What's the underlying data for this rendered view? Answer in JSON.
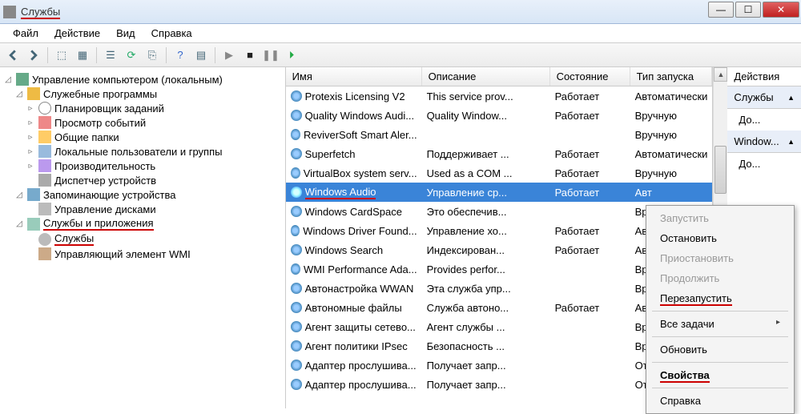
{
  "window": {
    "title": "Службы",
    "menu": [
      "Файл",
      "Действие",
      "Вид",
      "Справка"
    ]
  },
  "tree": {
    "root": "Управление компьютером (локальным)",
    "groups": [
      {
        "label": "Служебные программы",
        "items": [
          "Планировщик заданий",
          "Просмотр событий",
          "Общие папки",
          "Локальные пользователи и группы",
          "Производительность",
          "Диспетчер устройств"
        ]
      },
      {
        "label": "Запоминающие устройства",
        "items": [
          "Управление дисками"
        ]
      },
      {
        "label": "Службы и приложения",
        "items": [
          "Службы",
          "Управляющий элемент WMI"
        ]
      }
    ]
  },
  "columns": {
    "name": "Имя",
    "desc": "Описание",
    "state": "Состояние",
    "start": "Тип запуска"
  },
  "services": [
    {
      "name": "Protexis Licensing V2",
      "desc": "This service prov...",
      "state": "Работает",
      "start": "Автоматически"
    },
    {
      "name": "Quality Windows Audi...",
      "desc": "Quality Window...",
      "state": "Работает",
      "start": "Вручную"
    },
    {
      "name": "ReviverSoft Smart Aler...",
      "desc": "",
      "state": "",
      "start": "Вручную"
    },
    {
      "name": "Superfetch",
      "desc": "Поддерживает ...",
      "state": "Работает",
      "start": "Автоматически"
    },
    {
      "name": "VirtualBox system serv...",
      "desc": "Used as a COM ...",
      "state": "Работает",
      "start": "Вручную"
    },
    {
      "name": "Windows Audio",
      "desc": "Управление ср...",
      "state": "Работает",
      "start": "Авт"
    },
    {
      "name": "Windows CardSpace",
      "desc": "Это обеспечив...",
      "state": "",
      "start": "Вру"
    },
    {
      "name": "Windows Driver Found...",
      "desc": "Управление хо...",
      "state": "Работает",
      "start": "Авт"
    },
    {
      "name": "Windows Search",
      "desc": "Индексирован...",
      "state": "Работает",
      "start": "Авт"
    },
    {
      "name": "WMI Performance Ada...",
      "desc": "Provides perfor...",
      "state": "",
      "start": "Вру"
    },
    {
      "name": "Автонастройка WWAN",
      "desc": "Эта служба упр...",
      "state": "",
      "start": "Вру"
    },
    {
      "name": "Автономные файлы",
      "desc": "Служба автоно...",
      "state": "Работает",
      "start": "Авт"
    },
    {
      "name": "Агент защиты сетево...",
      "desc": "Агент службы ...",
      "state": "",
      "start": "Вру"
    },
    {
      "name": "Агент политики IPsec",
      "desc": "Безопасность ...",
      "state": "",
      "start": "Вру"
    },
    {
      "name": "Адаптер прослушива...",
      "desc": "Получает запр...",
      "state": "",
      "start": "Отк"
    },
    {
      "name": "Адаптер прослушива...",
      "desc": "Получает запр...",
      "state": "",
      "start": "Отк"
    }
  ],
  "selected_index": 5,
  "actions": {
    "title": "Действия",
    "sub1": "Службы",
    "item1": "До...",
    "sub2": "Window...",
    "item2": "До..."
  },
  "context_menu": [
    {
      "label": "Запустить",
      "disabled": true
    },
    {
      "label": "Остановить"
    },
    {
      "label": "Приостановить",
      "disabled": true
    },
    {
      "label": "Продолжить",
      "disabled": true
    },
    {
      "label": "Перезапустить",
      "underlined": true
    },
    {
      "divider": true
    },
    {
      "label": "Все задачи",
      "arrow": true
    },
    {
      "divider": true
    },
    {
      "label": "Обновить"
    },
    {
      "divider": true
    },
    {
      "label": "Свойства",
      "bold": true,
      "underlined": true
    },
    {
      "divider": true
    },
    {
      "label": "Справка"
    }
  ]
}
